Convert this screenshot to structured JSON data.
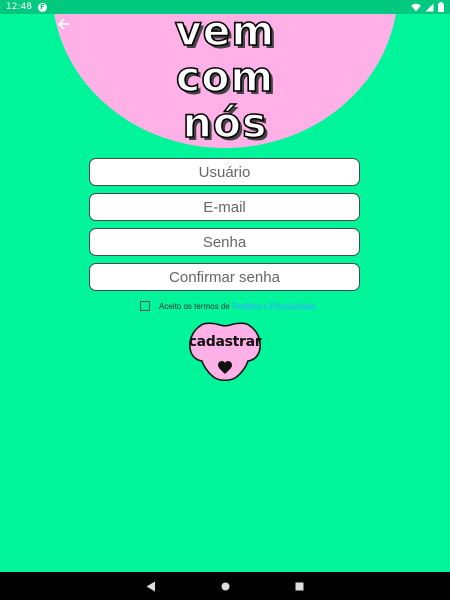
{
  "status_bar": {
    "time": "12:48",
    "app_badge": "F"
  },
  "header": {
    "title_lines": [
      "vem",
      "com",
      "nós"
    ]
  },
  "form": {
    "username_placeholder": "Usuário",
    "email_placeholder": "E-mail",
    "password_placeholder": "Senha",
    "confirm_password_placeholder": "Confirmar senha"
  },
  "terms": {
    "text": "Aceito os termos de",
    "link": "Política e Privacidade.",
    "checked": false
  },
  "register_button": {
    "label": "cadastrar"
  },
  "colors": {
    "background": "#00F59B",
    "status_bar": "#00C97F",
    "accent_pink": "#FFB0E6",
    "link": "#29B6F6"
  },
  "icons": {
    "back": "arrow-left-icon",
    "wifi": "wifi-icon",
    "signal": "signal-icon",
    "battery": "battery-icon",
    "nav_back": "triangle-back-icon",
    "nav_home": "circle-home-icon",
    "nav_recents": "square-recents-icon"
  }
}
